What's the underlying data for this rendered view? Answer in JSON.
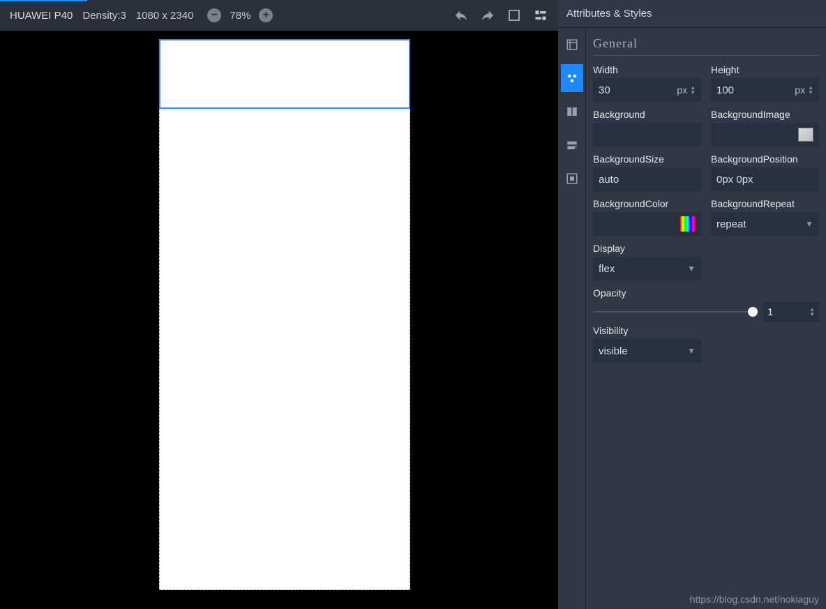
{
  "topbar": {
    "device_name": "HUAWEI P40",
    "density_label": "Density:3",
    "resolution": "1080 x 2340",
    "zoom_minus_icon": "−",
    "zoom_plus_icon": "+",
    "zoom_value": "78%"
  },
  "panel": {
    "title": "Attributes & Styles",
    "section": "General",
    "fields": {
      "width": {
        "label": "Width",
        "value": "30",
        "unit": "px"
      },
      "height": {
        "label": "Height",
        "value": "100",
        "unit": "px"
      },
      "background": {
        "label": "Background",
        "value": ""
      },
      "backgroundImage": {
        "label": "BackgroundImage",
        "value": ""
      },
      "backgroundSize": {
        "label": "BackgroundSize",
        "value": "auto"
      },
      "backgroundPosition": {
        "label": "BackgroundPosition",
        "value": "0px 0px"
      },
      "backgroundColor": {
        "label": "BackgroundColor",
        "value": ""
      },
      "backgroundRepeat": {
        "label": "BackgroundRepeat",
        "value": "repeat"
      },
      "display": {
        "label": "Display",
        "value": "flex"
      },
      "opacity": {
        "label": "Opacity",
        "value": "1"
      },
      "visibility": {
        "label": "Visibility",
        "value": "visible"
      }
    }
  },
  "watermark": "https://blog.csdn.net/nokiaguy"
}
